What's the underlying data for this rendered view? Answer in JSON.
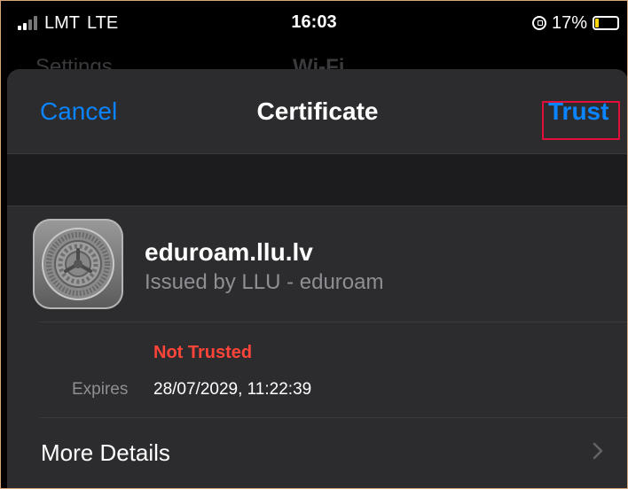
{
  "status_bar": {
    "carrier": "LMT",
    "network": "LTE",
    "time": "16:03",
    "battery_percent": "17%",
    "battery_level": 0.17,
    "icons": [
      "signal-icon",
      "rotation-lock-icon",
      "battery-icon"
    ]
  },
  "background_nav": {
    "back_label": "Settings",
    "title": "Wi-Fi"
  },
  "sheet": {
    "cancel_label": "Cancel",
    "title": "Certificate",
    "trust_label": "Trust"
  },
  "certificate": {
    "name": "eduroam.llu.lv",
    "issuer": "Issued by LLU - eduroam",
    "trust_status": "Not Trusted",
    "expires_label": "Expires",
    "expires_value": "28/07/2029, 11:22:39",
    "more_details_label": "More Details",
    "icon": "settings-gear-icon"
  },
  "colors": {
    "accent": "#0a84ff",
    "warning": "#ff453a",
    "highlight_box": "#e0103a",
    "sheet_bg": "#1c1c1e",
    "card_bg": "#2c2c2e"
  }
}
